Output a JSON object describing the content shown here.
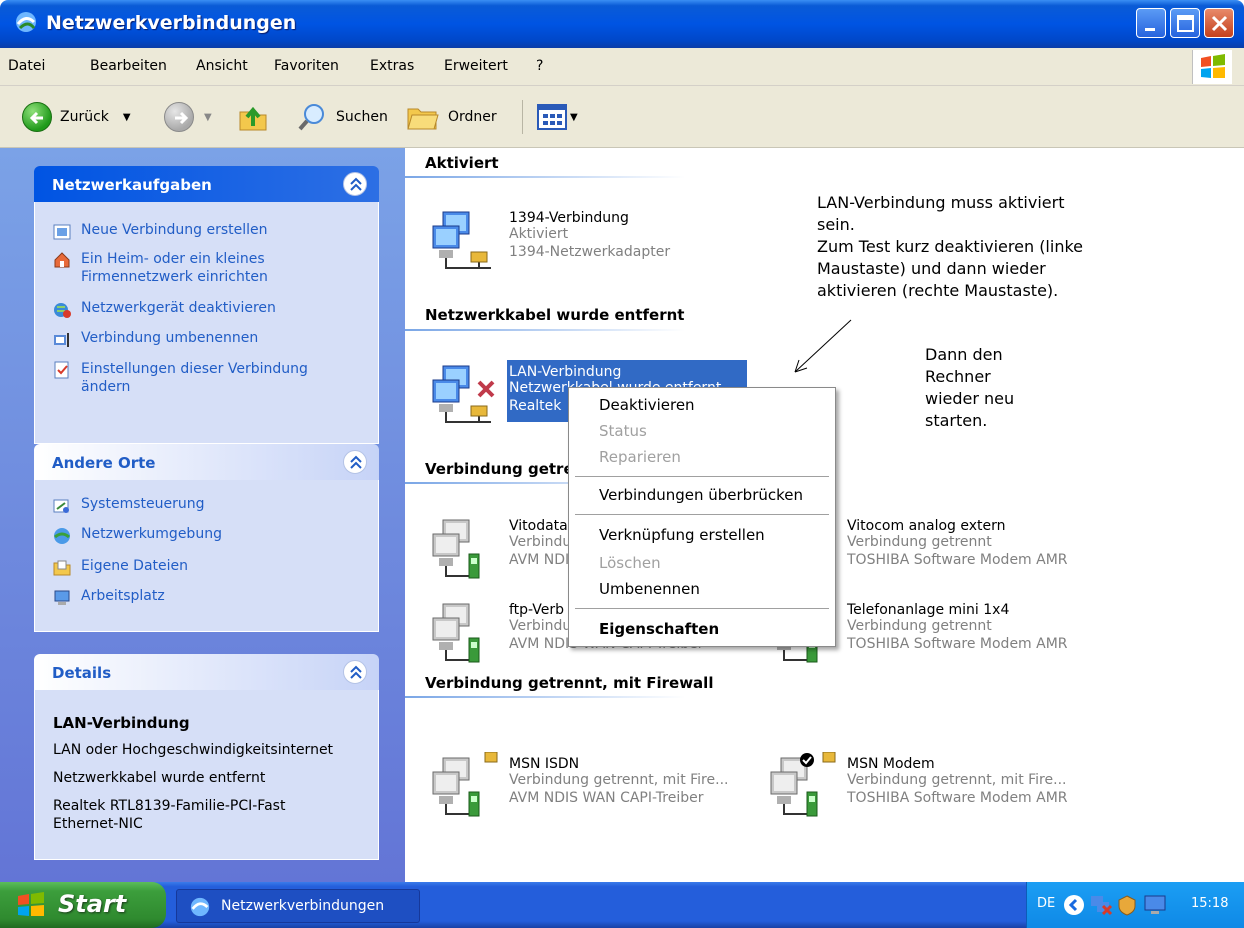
{
  "window": {
    "title": "Netzwerkverbindungen"
  },
  "menu": [
    "Datei",
    "Bearbeiten",
    "Ansicht",
    "Favoriten",
    "Extras",
    "Erweitert",
    "?"
  ],
  "toolbar": {
    "back": "Zurück",
    "search": "Suchen",
    "folders": "Ordner"
  },
  "left": {
    "network_tasks": {
      "title": "Netzwerkaufgaben",
      "items": [
        "Neue Verbindung erstellen",
        "Ein Heim- oder ein kleines",
        "Firmennetzwerk einrichten",
        "Netzwerkgerät deaktivieren",
        "Verbindung umbenennen",
        "Einstellungen dieser Verbindung",
        "ändern"
      ]
    },
    "other_places": {
      "title": "Andere Orte",
      "items": [
        "Systemsteuerung",
        "Netzwerkumgebung",
        "Eigene Dateien",
        "Arbeitsplatz"
      ]
    },
    "details": {
      "title": "Details",
      "name": "LAN-Verbindung",
      "lines": [
        "LAN oder Hochgeschwindigkeitsinternet",
        "Netzwerkkabel wurde entfernt",
        "Realtek RTL8139-Familie-PCI-Fast",
        "Ethernet-NIC"
      ]
    }
  },
  "groups": {
    "enabled": "Aktiviert",
    "cable_removed": "Netzwerkkabel wurde entfernt",
    "disconnected": "Verbindung getrennt",
    "disconnected_firewall": "Verbindung getrennt, mit Firewall"
  },
  "connections": {
    "c1394": {
      "name": "1394-Verbindung",
      "status": "Aktiviert",
      "device": "1394-Netzwerkadapter"
    },
    "lan": {
      "name": "LAN-Verbindung",
      "status": "Netzwerkkabel wurde entfernt",
      "device": "Realtek"
    },
    "vitodata": {
      "name": "Vitodata",
      "status": "Verbindung",
      "device": "AVM NDIS"
    },
    "vitocom": {
      "name": "Vitocom analog extern",
      "status": "Verbindung getrennt",
      "device": "TOSHIBA Software Modem AMR"
    },
    "ftp": {
      "name": "ftp-Verb",
      "status": "Verbindung",
      "device": "AVM NDIS WAN CAPI-Treiber"
    },
    "telefon": {
      "name": "Telefonanlage mini 1x4",
      "status": "Verbindung getrennt",
      "device": "TOSHIBA Software Modem AMR"
    },
    "msn_isdn": {
      "name": "MSN ISDN",
      "status": "Verbindung getrennt, mit Fire...",
      "device": "AVM NDIS WAN CAPI-Treiber"
    },
    "msn_modem": {
      "name": "MSN Modem",
      "status": "Verbindung getrennt, mit Fire...",
      "device": "TOSHIBA Software Modem AMR"
    }
  },
  "context_menu": {
    "disable": "Deaktivieren",
    "status": "Status",
    "repair": "Reparieren",
    "bridge": "Verbindungen überbrücken",
    "shortcut": "Verknüpfung erstellen",
    "delete": "Löschen",
    "rename": "Umbenennen",
    "properties": "Eigenschaften"
  },
  "notes": {
    "note1": [
      "LAN-Verbindung muss aktiviert",
      "sein.",
      "Zum Test kurz deaktivieren (linke",
      "Maustaste) und dann wieder",
      "aktivieren (rechte Maustaste)."
    ],
    "note2": [
      "Dann den",
      "Rechner",
      "wieder neu",
      "starten."
    ]
  },
  "taskbar": {
    "start": "Start",
    "window": "Netzwerkverbindungen",
    "lang": "DE",
    "clock": "15:18"
  }
}
